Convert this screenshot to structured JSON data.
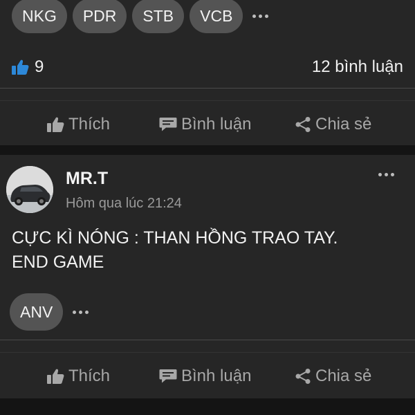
{
  "post1": {
    "tags": [
      "NKG",
      "PDR",
      "STB",
      "VCB"
    ],
    "like_count": "9",
    "comment_count": "12 bình luận",
    "actions": {
      "like": "Thích",
      "comment": "Bình luận",
      "share": "Chia sẻ"
    }
  },
  "post2": {
    "author": "MR.T",
    "time": "Hôm qua lúc 21:24",
    "text_line1": "CỰC KÌ NÓNG :  THAN HỒNG TRAO TAY.",
    "text_line2": "END GAME",
    "tags": [
      "ANV"
    ],
    "actions": {
      "like": "Thích",
      "comment": "Bình luận",
      "share": "Chia sẻ"
    }
  },
  "colors": {
    "background": "#141414",
    "card": "#262626",
    "tag": "#545454",
    "like_blue": "#2d88d8",
    "muted_text": "#a8a8a8"
  },
  "icons": [
    "thumbs-up-icon",
    "comment-icon",
    "share-icon",
    "more-dots-icon"
  ]
}
